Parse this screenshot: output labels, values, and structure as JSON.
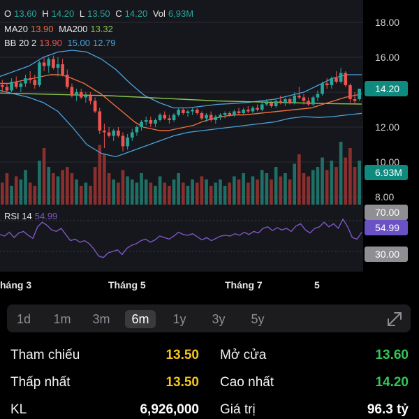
{
  "legend": {
    "o_label": "O",
    "o_value": "13.60",
    "h_label": "H",
    "h_value": "14.20",
    "l_label": "L",
    "l_value": "13.50",
    "c_label": "C",
    "c_value": "14.20",
    "vol_label": "Vol",
    "vol_value": "6,93M",
    "ma20_label": "MA20",
    "ma20_value": "13.90",
    "ma200_label": "MA200",
    "ma200_value": "13.32",
    "bb_label": "BB 20 2",
    "bb_mid": "13.90",
    "bb_upper": "15.00",
    "bb_lower": "12.79"
  },
  "rsi": {
    "label": "RSI 14",
    "value": "54.99"
  },
  "price_badge": "14.20",
  "volume_badge": "6.93M",
  "chart_data": {
    "type": "candlestick",
    "price_axis": {
      "ticks": [
        "18.00",
        "16.00",
        "14.00",
        "12.00",
        "10.00",
        "8.00"
      ],
      "ylim": [
        8,
        18
      ]
    },
    "rsi_axis": {
      "ticks": [
        "70.00",
        "54.99",
        "30.00"
      ]
    },
    "x_labels": [
      "háng 3",
      "Tháng 5",
      "Tháng 7",
      "5"
    ],
    "candles": [
      [
        14.4,
        14.7,
        14.0,
        14.3
      ],
      [
        14.3,
        14.5,
        13.9,
        14.1
      ],
      [
        14.1,
        14.8,
        14.0,
        14.6
      ],
      [
        14.6,
        14.9,
        14.2,
        14.3
      ],
      [
        14.3,
        14.6,
        14.0,
        14.5
      ],
      [
        14.5,
        15.0,
        14.3,
        14.8
      ],
      [
        14.8,
        15.2,
        14.5,
        14.7
      ],
      [
        14.7,
        15.0,
        14.2,
        14.4
      ],
      [
        14.4,
        15.8,
        14.3,
        15.7
      ],
      [
        15.7,
        16.0,
        15.2,
        15.5
      ],
      [
        15.5,
        16.0,
        15.1,
        15.9
      ],
      [
        15.9,
        16.1,
        15.3,
        15.4
      ],
      [
        15.4,
        16.0,
        14.9,
        15.6
      ],
      [
        15.6,
        15.9,
        14.9,
        15.0
      ],
      [
        15.0,
        15.3,
        14.2,
        14.3
      ],
      [
        14.3,
        14.5,
        13.7,
        13.8
      ],
      [
        13.8,
        14.2,
        13.5,
        14.0
      ],
      [
        14.0,
        14.2,
        13.6,
        13.7
      ],
      [
        13.7,
        14.0,
        13.4,
        13.8
      ],
      [
        13.8,
        14.0,
        13.3,
        13.5
      ],
      [
        13.5,
        13.7,
        12.8,
        12.9
      ],
      [
        12.9,
        13.1,
        11.6,
        11.8
      ],
      [
        11.8,
        12.2,
        10.8,
        11.7
      ],
      [
        11.7,
        12.0,
        11.4,
        11.5
      ],
      [
        11.5,
        11.9,
        11.2,
        11.8
      ],
      [
        11.8,
        12.0,
        11.4,
        11.5
      ],
      [
        11.5,
        11.7,
        10.6,
        10.9
      ],
      [
        10.9,
        11.6,
        10.7,
        11.4
      ],
      [
        11.4,
        11.9,
        11.2,
        11.7
      ],
      [
        11.7,
        12.1,
        11.5,
        12.0
      ],
      [
        12.0,
        12.4,
        11.8,
        12.3
      ],
      [
        12.3,
        12.6,
        12.1,
        12.4
      ],
      [
        12.4,
        12.6,
        12.0,
        12.2
      ],
      [
        12.2,
        12.5,
        12.0,
        12.4
      ],
      [
        12.4,
        12.8,
        12.3,
        12.7
      ],
      [
        12.7,
        12.9,
        12.4,
        12.5
      ],
      [
        12.5,
        12.7,
        12.2,
        12.4
      ],
      [
        12.4,
        12.8,
        12.3,
        12.7
      ],
      [
        12.7,
        13.1,
        12.6,
        13.0
      ],
      [
        13.0,
        13.1,
        12.7,
        12.8
      ],
      [
        12.8,
        13.0,
        12.6,
        12.9
      ],
      [
        12.9,
        13.1,
        12.7,
        13.0
      ],
      [
        13.0,
        13.1,
        12.7,
        12.8
      ],
      [
        12.8,
        12.9,
        12.4,
        12.5
      ],
      [
        12.5,
        12.8,
        12.3,
        12.7
      ],
      [
        12.7,
        12.9,
        12.3,
        12.4
      ],
      [
        12.4,
        12.7,
        12.2,
        12.6
      ],
      [
        12.6,
        12.8,
        12.4,
        12.7
      ],
      [
        12.7,
        12.9,
        12.5,
        12.8
      ],
      [
        12.8,
        12.9,
        12.6,
        12.7
      ],
      [
        12.7,
        13.0,
        12.6,
        12.9
      ],
      [
        12.9,
        13.1,
        12.7,
        12.8
      ],
      [
        12.8,
        13.1,
        12.7,
        13.0
      ],
      [
        13.0,
        13.2,
        12.8,
        12.9
      ],
      [
        12.9,
        13.2,
        12.8,
        13.1
      ],
      [
        13.1,
        13.3,
        12.9,
        13.0
      ],
      [
        13.0,
        13.4,
        12.9,
        13.3
      ],
      [
        13.3,
        13.6,
        13.2,
        13.4
      ],
      [
        13.4,
        13.5,
        13.1,
        13.2
      ],
      [
        13.2,
        13.6,
        13.1,
        13.5
      ],
      [
        13.5,
        13.8,
        13.3,
        13.4
      ],
      [
        13.4,
        13.7,
        13.2,
        13.6
      ],
      [
        13.6,
        13.7,
        13.3,
        13.4
      ],
      [
        13.4,
        14.0,
        13.3,
        13.8
      ],
      [
        13.8,
        14.3,
        13.6,
        13.7
      ],
      [
        13.7,
        13.9,
        13.3,
        13.5
      ],
      [
        13.5,
        13.7,
        13.2,
        13.3
      ],
      [
        13.3,
        13.8,
        13.2,
        13.7
      ],
      [
        13.7,
        14.1,
        13.5,
        13.9
      ],
      [
        13.9,
        14.6,
        13.8,
        14.5
      ],
      [
        14.5,
        14.8,
        14.2,
        14.4
      ],
      [
        14.4,
        14.9,
        14.2,
        14.8
      ],
      [
        14.8,
        15.2,
        14.5,
        14.6
      ],
      [
        14.6,
        15.4,
        14.5,
        15.1
      ],
      [
        15.1,
        15.2,
        14.3,
        14.4
      ],
      [
        14.4,
        14.5,
        13.4,
        13.6
      ],
      [
        13.6,
        14.0,
        13.3,
        13.5
      ],
      [
        13.6,
        14.2,
        13.5,
        14.2
      ]
    ],
    "volume_relative": [
      0.35,
      0.5,
      0.3,
      0.45,
      0.4,
      0.55,
      0.35,
      0.3,
      0.7,
      0.9,
      0.6,
      0.5,
      0.45,
      0.55,
      0.6,
      0.5,
      0.4,
      0.3,
      0.35,
      0.3,
      0.6,
      0.95,
      0.8,
      0.5,
      0.4,
      0.35,
      0.55,
      0.45,
      0.4,
      0.35,
      0.5,
      0.4,
      0.35,
      0.3,
      0.45,
      0.35,
      0.3,
      0.4,
      0.5,
      0.35,
      0.3,
      0.4,
      0.35,
      0.45,
      0.4,
      0.3,
      0.35,
      0.4,
      0.3,
      0.35,
      0.45,
      0.4,
      0.5,
      0.35,
      0.45,
      0.4,
      0.55,
      0.5,
      0.4,
      0.6,
      0.45,
      0.5,
      0.4,
      0.65,
      0.8,
      0.5,
      0.45,
      0.55,
      0.6,
      0.75,
      0.55,
      0.7,
      0.6,
      1.0,
      0.75,
      0.9,
      0.6,
      0.7
    ],
    "rsi_values": [
      52,
      50,
      55,
      48,
      54,
      56,
      51,
      47,
      62,
      68,
      64,
      58,
      56,
      60,
      52,
      44,
      46,
      42,
      44,
      40,
      33,
      24,
      22,
      28,
      30,
      32,
      26,
      34,
      38,
      40,
      44,
      46,
      42,
      45,
      50,
      48,
      46,
      50,
      55,
      52,
      51,
      53,
      49,
      45,
      48,
      44,
      47,
      50,
      51,
      50,
      53,
      51,
      55,
      52,
      56,
      54,
      60,
      62,
      57,
      61,
      58,
      60,
      56,
      63,
      66,
      58,
      54,
      60,
      62,
      68,
      62,
      66,
      60,
      72,
      62,
      48,
      46,
      55
    ],
    "ma20": [
      14.5,
      14.5,
      14.6,
      14.7,
      14.8,
      14.9,
      15.0,
      15.0,
      14.9,
      14.7,
      14.5,
      14.2,
      13.9,
      13.5,
      13.1,
      12.7,
      12.3,
      12.0,
      11.9,
      11.8,
      11.8,
      11.9,
      12.0,
      12.1,
      12.3,
      12.45,
      12.55,
      12.65,
      12.7,
      12.7,
      12.75,
      12.8,
      12.85,
      12.9,
      12.95,
      13.0,
      13.05,
      13.1,
      13.25,
      13.4,
      13.55,
      13.7,
      13.8,
      13.9
    ],
    "ma200": [
      13.95,
      13.9,
      13.85,
      13.8,
      13.7,
      13.6,
      13.5,
      13.45,
      13.4,
      13.35,
      13.32
    ],
    "bb_upper": [
      14.9,
      15.2,
      15.5,
      16.0,
      16.3,
      16.4,
      16.3,
      15.9,
      15.3,
      14.5,
      13.8,
      13.4,
      13.1,
      13.1,
      13.2,
      13.3,
      13.35,
      13.4,
      13.5,
      13.6,
      13.8,
      14.0,
      14.4,
      14.8,
      15.0,
      15.0
    ],
    "bb_lower": [
      14.1,
      13.9,
      13.7,
      13.4,
      12.9,
      12.0,
      11.0,
      10.5,
      10.3,
      10.6,
      10.9,
      11.2,
      11.5,
      11.7,
      11.8,
      11.9,
      12.0,
      12.1,
      12.2,
      12.3,
      12.5,
      12.6,
      12.55,
      12.6,
      12.7,
      12.79
    ]
  },
  "ranges": [
    "1d",
    "1m",
    "3m",
    "6m",
    "1y",
    "3y",
    "5y"
  ],
  "active_range": "6m",
  "stats": {
    "ref_label": "Tham chiếu",
    "ref_value": "13.50",
    "open_label": "Mở cửa",
    "open_value": "13.60",
    "low_label": "Thấp nhất",
    "low_value": "13.50",
    "high_label": "Cao nhất",
    "high_value": "14.20",
    "vol_label": "KL",
    "vol_value": "6,926,000",
    "val_label": "Giá trị",
    "val_value": "96.3 tỷ"
  },
  "colors": {
    "up": "#26a69a",
    "down": "#ef5350",
    "ma20": "#f0703c",
    "ma200": "#8bc34a",
    "bb": "#4aa3df",
    "rsi": "#7e57c2",
    "yellow": "#f5c518",
    "green": "#34c759"
  }
}
